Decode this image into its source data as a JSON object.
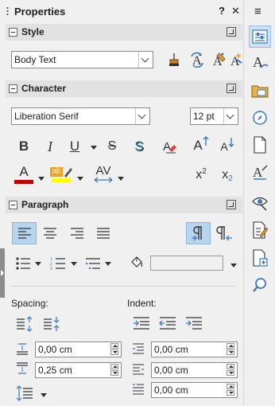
{
  "panel": {
    "title": "Properties",
    "help_label": "?",
    "close_label": "✕",
    "menu_label": "≡"
  },
  "style_section": {
    "header": "Style",
    "style_value": "Body Text"
  },
  "character_section": {
    "header": "Character",
    "font_name": "Liberation Serif",
    "font_size": "12 pt",
    "bold": "B",
    "italic": "I",
    "underline": "U",
    "strike": "S",
    "shadow": "S",
    "grow": "A",
    "shrink": "A",
    "font_color": "A",
    "highlight": "ab",
    "spacing": "AV",
    "superscript": "x",
    "superscript_mark": "2",
    "subscript": "x",
    "subscript_mark": "2",
    "font_color_value": "#c00000",
    "highlight_color_value": "#ffff00"
  },
  "paragraph_section": {
    "header": "Paragraph",
    "spacing_label": "Spacing:",
    "indent_label": "Indent:",
    "above_spacing": "0,00 cm",
    "below_spacing": "0,25 cm",
    "before_indent": "0,00 cm",
    "after_indent": "0,00 cm",
    "first_line_indent": "0,00 cm"
  },
  "sidebar": {
    "items": [
      "properties-icon",
      "styles-icon",
      "gallery-icon",
      "navigator-icon",
      "page-icon",
      "style-inspector-icon",
      "manage-changes-icon",
      "design-icon",
      "accessibility-check-icon",
      "find-icon"
    ]
  },
  "colors": {
    "accent": "#3b78c3",
    "active_bg": "#b9d4ee"
  }
}
